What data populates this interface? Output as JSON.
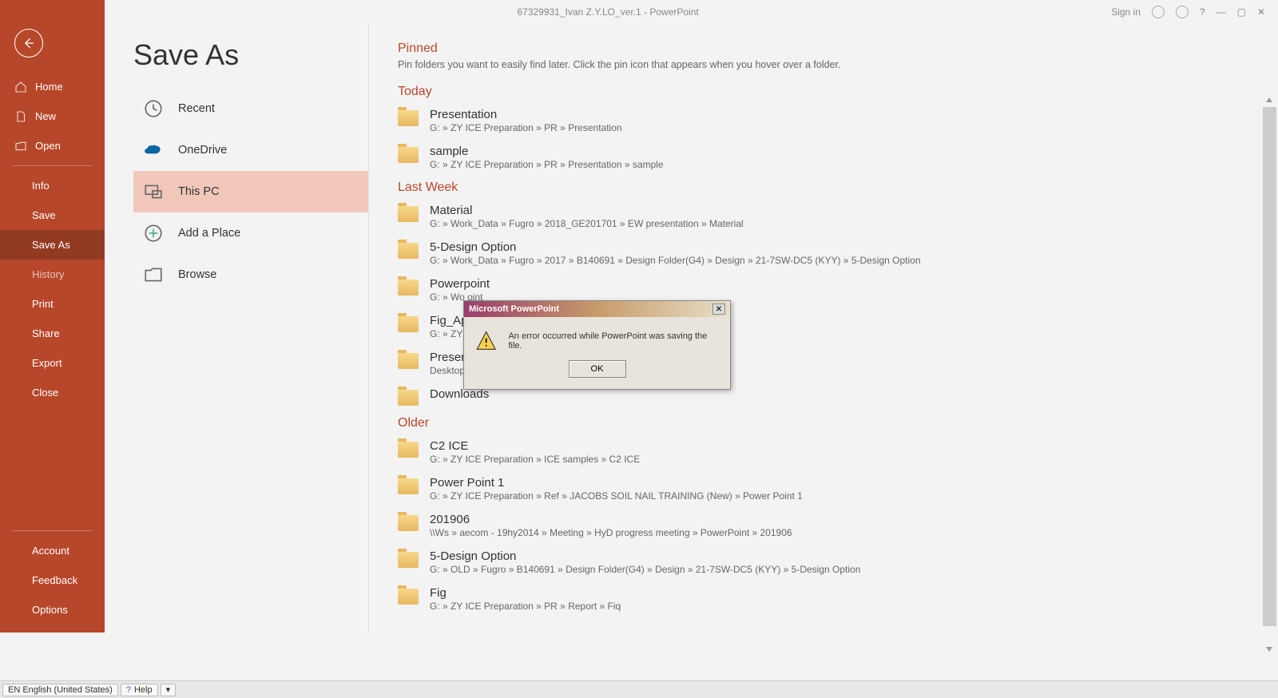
{
  "title": "67329931_Ivan Z.Y.LO_ver.1  -  PowerPoint",
  "titlebar": {
    "signin": "Sign in",
    "help": "?",
    "min": "—",
    "max": "▢",
    "close": "✕"
  },
  "page_header": "Save As",
  "sidebar": {
    "home": "Home",
    "new": "New",
    "open": "Open",
    "info": "Info",
    "save": "Save",
    "saveas": "Save As",
    "history": "History",
    "print": "Print",
    "share": "Share",
    "export": "Export",
    "close": "Close",
    "account": "Account",
    "feedback": "Feedback",
    "options": "Options"
  },
  "locations": {
    "recent": "Recent",
    "onedrive": "OneDrive",
    "thispc": "This PC",
    "addplace": "Add a Place",
    "browse": "Browse"
  },
  "sections": {
    "pinned": {
      "title": "Pinned",
      "hint": "Pin folders you want to easily find later. Click the pin icon that appears when you hover over a folder."
    },
    "today": {
      "title": "Today",
      "items": [
        {
          "name": "Presentation",
          "path": "G: » ZY ICE Preparation » PR » Presentation"
        },
        {
          "name": "sample",
          "path": "G: » ZY ICE Preparation » PR » Presentation » sample"
        }
      ]
    },
    "lastweek": {
      "title": "Last Week",
      "items": [
        {
          "name": "Material",
          "path": "G: » Work_Data » Fugro » 2018_GE201701 » EW presentation » Material"
        },
        {
          "name": "5-Design Option",
          "path": "G: » Work_Data » Fugro » 2017 » B140691 » Design Folder(G4) » Design » 21-7SW-DC5 (KYY) » 5-Design Option"
        },
        {
          "name": "Powerpoint",
          "path": "G: » Wo                                                                                                              oint"
        },
        {
          "name": "Fig_Ap",
          "path": "G: » ZY"
        },
        {
          "name": "Presen",
          "path": "Desktop » 19_HY_2014_ZYL » Print » ZYL » ICE » Present"
        },
        {
          "name": "Downloads",
          "path": ""
        }
      ]
    },
    "older": {
      "title": "Older",
      "items": [
        {
          "name": "C2 ICE",
          "path": "G: » ZY ICE Preparation » ICE samples » C2 ICE"
        },
        {
          "name": "Power Point 1",
          "path": "G: » ZY ICE Preparation » Ref » JACOBS SOIL NAIL TRAINING (New) » Power Point 1"
        },
        {
          "name": "201906",
          "path": "\\\\Ws » aecom - 19hy2014 » Meeting » HyD progress meeting » PowerPoint » 201906"
        },
        {
          "name": "5-Design Option",
          "path": "G: » OLD » Fugro » B140691 » Design Folder(G4) » Design » 21-7SW-DC5 (KYY) » 5-Design Option"
        },
        {
          "name": "Fig",
          "path": "G: » ZY ICE Preparation » PR » Report » Fiq"
        }
      ]
    }
  },
  "dialog": {
    "title": "Microsoft PowerPoint",
    "msg": "An error occurred while PowerPoint was saving the file.",
    "ok": "OK"
  },
  "status": {
    "lang": "EN English (United States)",
    "help": "Help"
  }
}
